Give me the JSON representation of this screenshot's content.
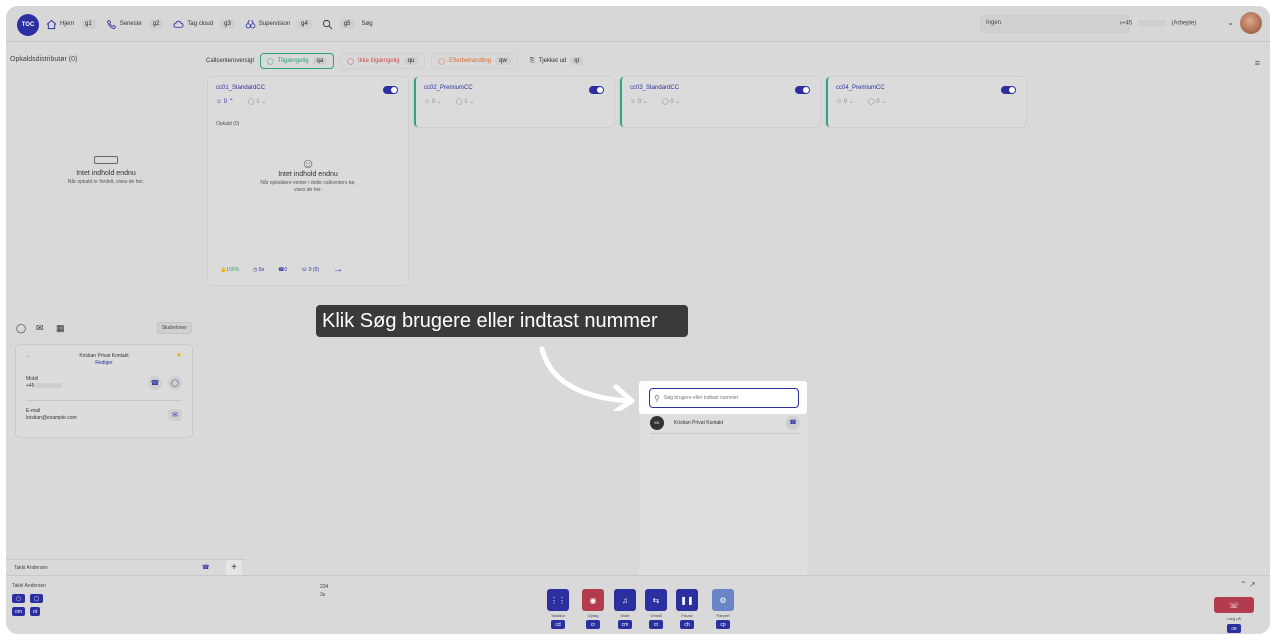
{
  "topbar": {
    "logo": "TOC",
    "nav": [
      {
        "label": "Hjem",
        "key": "g1",
        "icon": "home-icon"
      },
      {
        "label": "Seneste",
        "key": "g2",
        "icon": "phone-icon"
      },
      {
        "label": "Tag cloud",
        "key": "g3",
        "icon": "cloud-icon"
      },
      {
        "label": "Supervision",
        "key": "g4",
        "icon": "binoculars-icon"
      },
      {
        "label": "Søg",
        "key": "g5",
        "icon": "search-icon"
      }
    ],
    "status_value": "Ingen",
    "phone_prefix": "+45",
    "phone_type": "(Arbejde)"
  },
  "left_panel": {
    "title": "Opkaldsdistributør (0)",
    "empty_title": "Intet indhold endnu",
    "empty_sub": "Når opkald er fordelt, vises de her."
  },
  "cc_header": {
    "label": "Callcenteroversigt",
    "pills": [
      {
        "label": "Tilgængelig",
        "key": "qa"
      },
      {
        "label": "Ikke tilgængelig",
        "key": "qu"
      },
      {
        "label": "Efterbehandling",
        "key": "qw"
      },
      {
        "label": "Tjekket ud",
        "key": "ql"
      }
    ]
  },
  "cards": [
    {
      "name": "cc01_StandardCC",
      "agents": "0",
      "calls": "1"
    },
    {
      "name": "cc02_PremiumCC",
      "agents": "0",
      "calls": "1"
    },
    {
      "name": "cc03_StandardCC",
      "agents": "0",
      "calls": "0"
    },
    {
      "name": "cc04_PremiumCC",
      "agents": "0",
      "calls": "0"
    }
  ],
  "main_card": {
    "calls_label": "Opkald (0)",
    "empty_title": "Intet indhold endnu",
    "empty_sub": "Når opkaldere venter i dette callcenters kø, vises de her.",
    "footer": {
      "pct": "100%",
      "time": "0s",
      "answered": "0",
      "missed": "0 (0)"
    }
  },
  "chat_panel": {
    "templates": "Skabeloner",
    "contact_name": "Kristian Privat Kontakt",
    "edit": "Rediger",
    "mobile_label": "Mobil",
    "mobile_value": "+45",
    "email_label": "E-mail",
    "email_value": "kristian@example.com"
  },
  "agent_bar": {
    "name": "Takki Andersen"
  },
  "tooltip": {
    "text": "Klik Søg brugere eller indtast nummer"
  },
  "search": {
    "placeholder": "Søg brugere eller indtast nummer",
    "result_initials": "KK",
    "result_name": "Kristian Privat Kontakt"
  },
  "callbar": {
    "caller": "Takki Andersen",
    "left_keys": [
      "om",
      "ot"
    ],
    "counter_1": "234",
    "counter_2": "3s",
    "controls": [
      {
        "label": "Tastatur",
        "key": "cd"
      },
      {
        "label": "Optag",
        "key": "cr"
      },
      {
        "label": "Mute",
        "key": "cm"
      },
      {
        "label": "Omstil",
        "key": "ct"
      },
      {
        "label": "Pause",
        "key": "ch"
      },
      {
        "label": "Parpert",
        "key": "cp"
      }
    ],
    "hangup_label": "Læg på",
    "hangup_key": "ce"
  }
}
